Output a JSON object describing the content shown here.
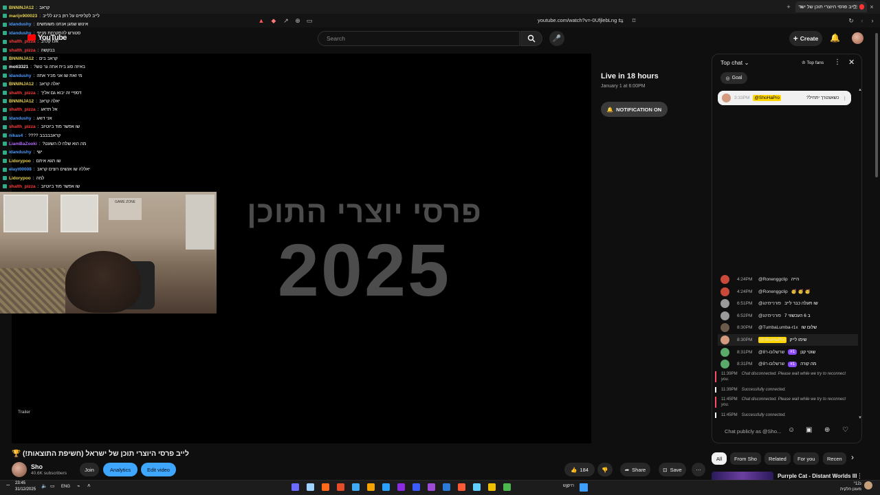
{
  "browser": {
    "tab_title": "לייב פרסי היוצרי תוכן של ישראל",
    "url": "youtube.com/watch?v=-0UfjlebLng"
  },
  "header": {
    "logo": "YouTube",
    "search_placeholder": "Search",
    "create_label": "Create"
  },
  "overlay_chat": [
    {
      "user": "BNNINJA12",
      "msg": "קראב",
      "color": "#e8d44d"
    },
    {
      "user": "marijn900023",
      "msg": "לייב לקליפים על רוזן בינג ללייב",
      "color": "#e8d44d"
    },
    {
      "user": "idandushy",
      "msg": "אינוש שמגן אנחנו משומשים",
      "color": "#4b9cff"
    },
    {
      "user": "idandushy",
      "msg": "סטורש להתקרחת מניוזי",
      "color": "#4b9cff"
    },
    {
      "user": "shalth_pizza",
      "msg": "אלו קלרב",
      "color": "#ff3b3b"
    },
    {
      "user": "shalth_pizza",
      "msg": "בבקשה",
      "color": "#ff3b3b"
    },
    {
      "user": "BNNINJA12",
      "msg": "קראב בים",
      "color": "#e8d44d"
    },
    {
      "user": "moti3321",
      "msg": "באיזה סוג בית אתה גר טש?",
      "color": "#ffffff"
    },
    {
      "user": "idandushy",
      "msg": "מי זאת שו אני מכיר אתה",
      "color": "#4b9cff"
    },
    {
      "user": "BNNINJA12",
      "msg": "יאלה קראב",
      "color": "#e8d44d"
    },
    {
      "user": "shalth_pizza",
      "msg": "דספיי זה יבוא גם אליך",
      "color": "#ff3b3b"
    },
    {
      "user": "BNNINJA12",
      "msg": "יאלה קראב",
      "color": "#e8d44d"
    },
    {
      "user": "shalth_pizza",
      "msg": "אל תדאג",
      "color": "#ff3b3b"
    },
    {
      "user": "idandushy",
      "msg": "אני דואג",
      "color": "#4b9cff"
    },
    {
      "user": "shalth_pizza",
      "msg": "שו אפשר מוד ביוטיוב",
      "color": "#ff3b3b"
    },
    {
      "user": "nikas4",
      "msg": "קראבבבבב ????",
      "color": "#4b9cff"
    },
    {
      "user": "LiamBaZooki",
      "msg": "מה הוא שלח לו השעט?",
      "color": "#b46cff"
    },
    {
      "user": "idandushy",
      "msg": "ישי",
      "color": "#4b9cff"
    },
    {
      "user": "Lidorypoo",
      "msg": "שו תגא איתם",
      "color": "#e8d44d"
    },
    {
      "user": "elayt00008",
      "msg": "יאללה שו אנשים רוצים קראב",
      "color": "#4b9cff"
    },
    {
      "user": "Lidorypoo",
      "msg": "למה",
      "color": "#e8d44d"
    },
    {
      "user": "shalth_pizza",
      "msg": "שו אפשר מוד ביוטיוב",
      "color": "#ff3b3b"
    }
  ],
  "player": {
    "overlay_line1": "פרסי יוצרי התוכן",
    "overlay_year": "2025",
    "trailer_label": "Trailer",
    "webcam_poster": "GAME ZONE"
  },
  "live": {
    "title": "Live in 18 hours",
    "date": "January 1 at 6:00PM",
    "notify_label": "NOTIFICATION ON"
  },
  "video": {
    "title": "לייב פרסי היוצרי תוכן של ישראל (חשיפת התוצאות!) 🏆",
    "channel": "Sho",
    "subs": "40.6K subscribers",
    "join": "Join",
    "analytics": "Analytics",
    "edit": "Edit video",
    "likes": "184",
    "share": "Share",
    "save": "Save"
  },
  "chat": {
    "mode": "Top chat",
    "top_fans": "Top fans",
    "goal": "Goal",
    "pinned_time": "3:33PM",
    "pinned_author": "@ShoHaPro",
    "pinned_msg": "כשאצטרך יתחיל?",
    "messages": [
      {
        "time": "4:24PM",
        "author": "@Ronenggclip",
        "text": "הייה",
        "av": "#c94a3a",
        "hl": false,
        "badge": ""
      },
      {
        "time": "4:24PM",
        "author": "@Ronenggclip",
        "text": "🥳 🥳 🥳",
        "av": "#c94a3a",
        "hl": false,
        "badge": ""
      },
      {
        "time": "6:51PM",
        "author": "@פורניימינג",
        "text": "שו תעלה כבר לייב",
        "av": "#9a9a9a",
        "hl": false,
        "badge": ""
      },
      {
        "time": "6:52PM",
        "author": "@פורניימינג",
        "text": "ב 6 העכשווי 7",
        "av": "#9a9a9a",
        "hl": false,
        "badge": ""
      },
      {
        "time": "8:30PM",
        "author": "@TumbaLumba-r1x",
        "text": "שלום שו",
        "av": "#6b5a4a",
        "hl": false,
        "badge": ""
      },
      {
        "time": "8:30PM",
        "author": "@ShoHaPro",
        "text": "שימו לייק",
        "av": "#d49a80",
        "hl": true,
        "badge": ""
      },
      {
        "time": "8:31PM",
        "author": "@שרשלום-ר8",
        "text": "שוטי קנן",
        "av": "#5aa86a",
        "hl": false,
        "badge": "#1"
      },
      {
        "time": "8:31PM",
        "author": "@שרשלום-ר8",
        "text": "מה קורה",
        "av": "#5aa86a",
        "hl": false,
        "badge": "#1"
      }
    ],
    "system": [
      {
        "time": "11:39PM",
        "text": "Chat disconnected. Please wait while we try to reconnect you.",
        "ok": false
      },
      {
        "time": "11:39PM",
        "text": "Successfully connected.",
        "ok": true
      },
      {
        "time": "11:45PM",
        "text": "Chat disconnected. Please wait while we try to reconnect you.",
        "ok": false
      },
      {
        "time": "11:45PM",
        "text": "Successfully connected.",
        "ok": true
      }
    ],
    "input_placeholder": "Chat publicly as @Sho..."
  },
  "related": {
    "chips": [
      "All",
      "From Sho",
      "Related",
      "For you",
      "Recen"
    ],
    "first_title": "Purrple Cat - Distant Worlds III"
  },
  "taskbar": {
    "time": "23:45",
    "date": "31/12/2025",
    "lang": "ENG",
    "search": "חיפוש",
    "weather_line1": "נ°12",
    "weather_line2": "מעונן חלקית"
  }
}
